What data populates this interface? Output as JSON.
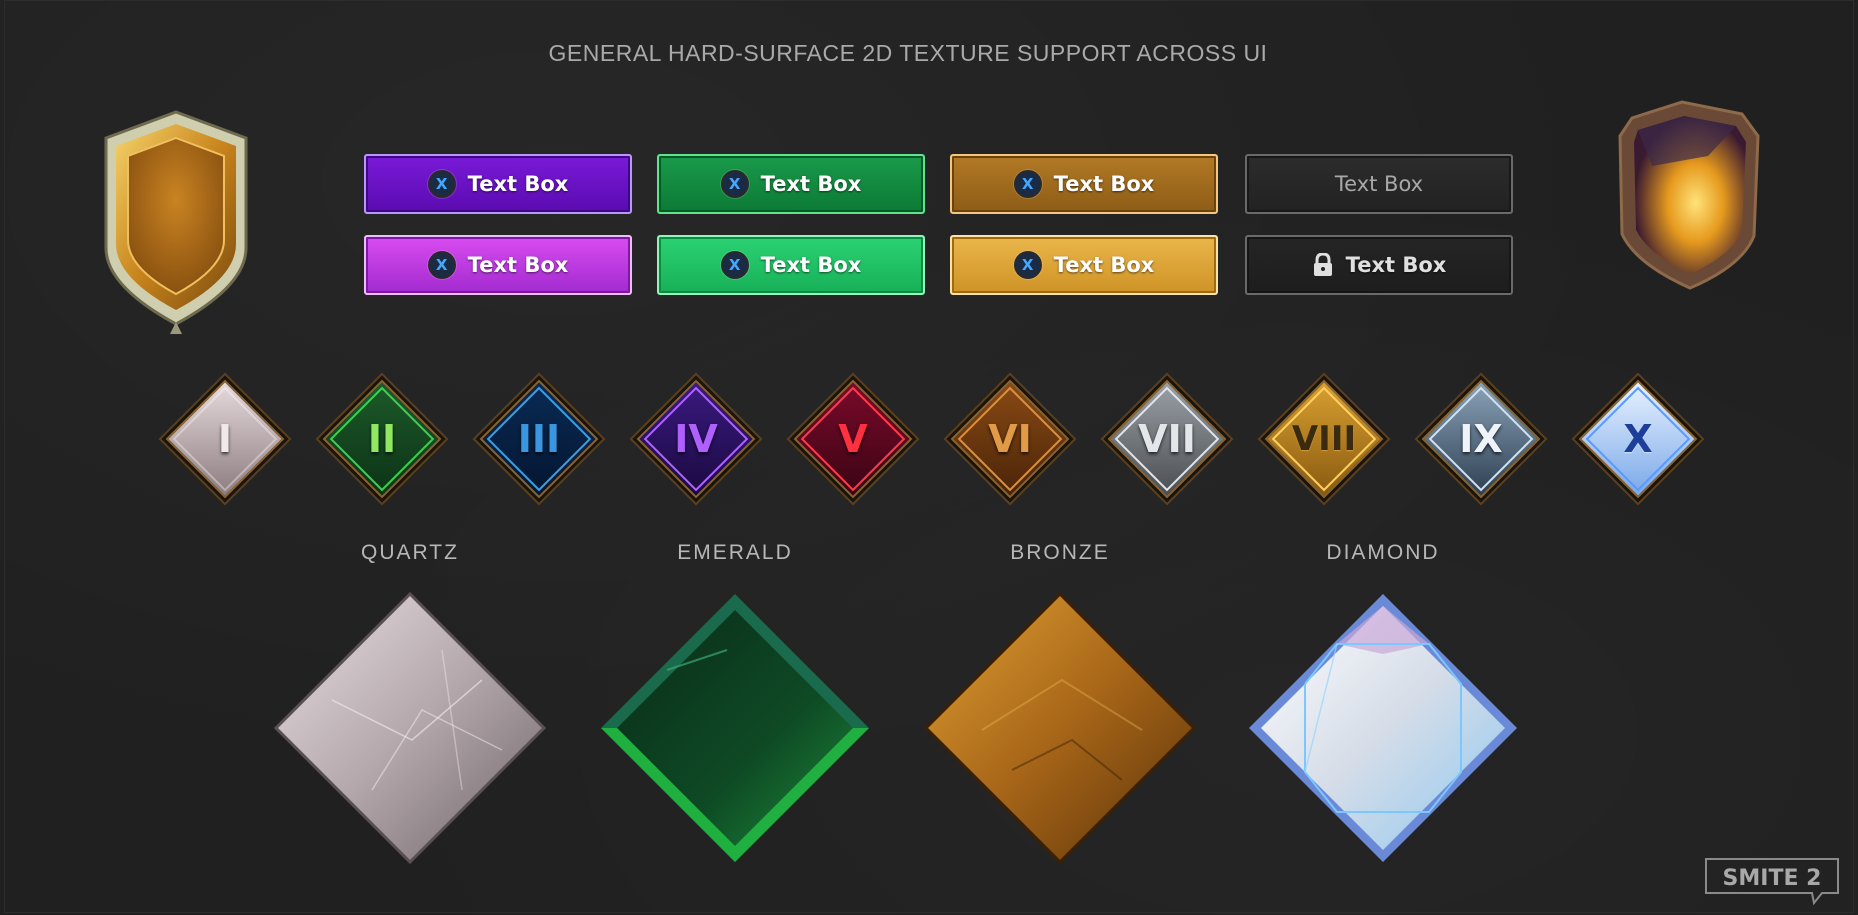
{
  "header": {
    "title": "GENERAL HARD-SURFACE 2D TEXTURE SUPPORT ACROSS UI"
  },
  "buttons": {
    "row1": [
      {
        "label": "Text Box",
        "icon": "x-button-icon",
        "style": "purple-dark"
      },
      {
        "label": "Text Box",
        "icon": "x-button-icon",
        "style": "green-dark"
      },
      {
        "label": "Text Box",
        "icon": "x-button-icon",
        "style": "gold-dark"
      },
      {
        "label": "Text Box",
        "icon": "",
        "style": "disabled"
      }
    ],
    "row2": [
      {
        "label": "Text Box",
        "icon": "x-button-icon",
        "style": "purple-light"
      },
      {
        "label": "Text Box",
        "icon": "x-button-icon",
        "style": "green-light"
      },
      {
        "label": "Text Box",
        "icon": "x-button-icon",
        "style": "gold-light"
      },
      {
        "label": "Text Box",
        "icon": "lock-icon",
        "style": "locked"
      }
    ],
    "x_glyph": "X"
  },
  "ranks": [
    {
      "numeral": "I",
      "color": "#bfb1b4"
    },
    {
      "numeral": "II",
      "color": "#7fe04e"
    },
    {
      "numeral": "III",
      "color": "#2e8fd6"
    },
    {
      "numeral": "IV",
      "color": "#a04df0"
    },
    {
      "numeral": "V",
      "color": "#e02a3a"
    },
    {
      "numeral": "VI",
      "color": "#d28a3a"
    },
    {
      "numeral": "VII",
      "color": "#cfd2d6"
    },
    {
      "numeral": "VIII",
      "color": "#3a2a10"
    },
    {
      "numeral": "IX",
      "color": "#e6eef6"
    },
    {
      "numeral": "X",
      "color": "#1d3f9a"
    }
  ],
  "tiers": [
    {
      "name": "QUARTZ"
    },
    {
      "name": "EMERALD"
    },
    {
      "name": "BRONZE"
    },
    {
      "name": "DIAMOND"
    }
  ],
  "logo": {
    "text": "SMITE 2"
  }
}
